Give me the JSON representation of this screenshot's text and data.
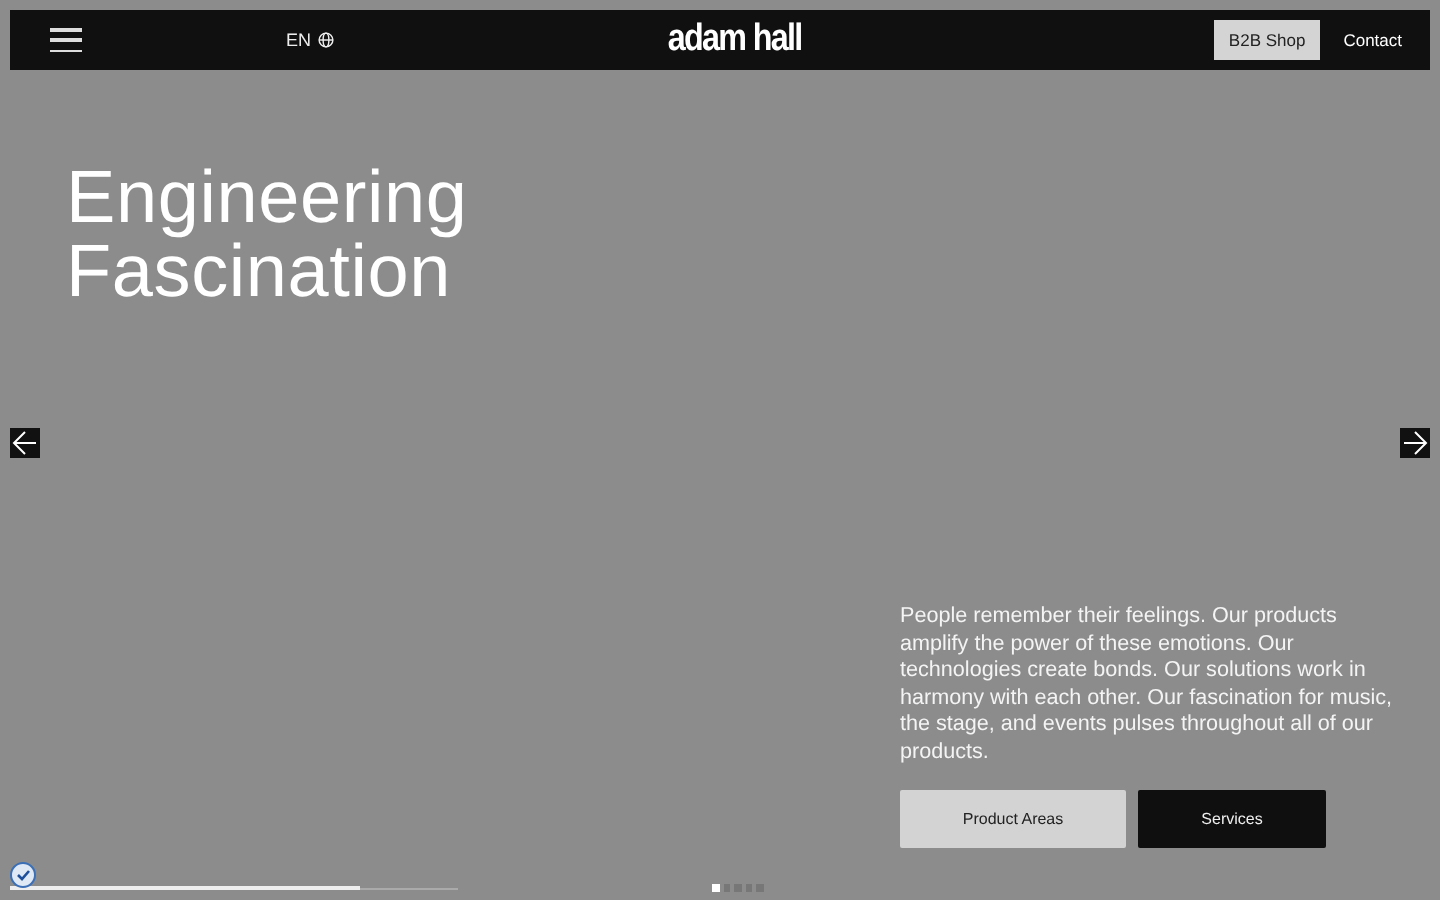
{
  "header": {
    "language": "EN",
    "logo": "adam hall",
    "b2b_button": "B2B Shop",
    "contact_link": "Contact"
  },
  "hero": {
    "title_lines": [
      "Engineering",
      "Fascination"
    ],
    "text": "People remember their feelings. Our products amplify the power of these emotions. Our technologies create bonds. Our solutions work in harmony with each other. Our fascination for music, the stage, and events pulses throughout all of our products.",
    "buttons": [
      {
        "label": "Product Areas",
        "kind": "light"
      },
      {
        "label": "Services",
        "kind": "dark"
      }
    ],
    "progress": {
      "level": 0.78
    },
    "slides": [
      {
        "selected": true
      },
      {
        "selected": false
      },
      {
        "selected": false
      },
      {
        "selected": false
      },
      {
        "selected": false
      }
    ]
  }
}
